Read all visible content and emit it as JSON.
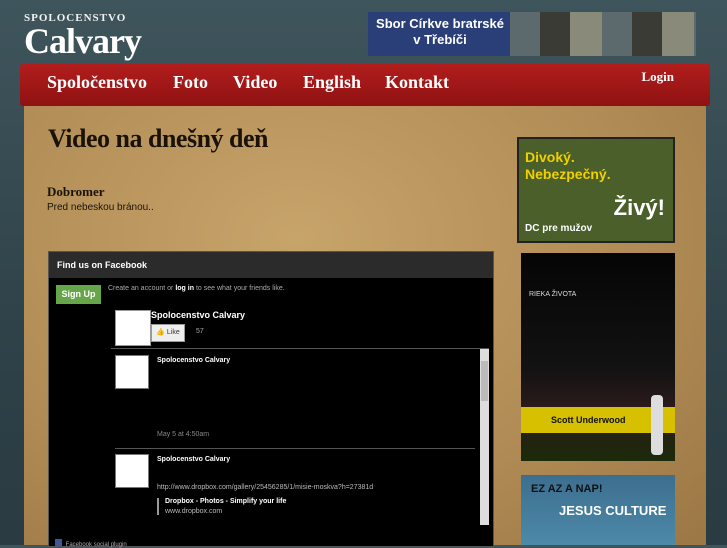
{
  "header": {
    "logo_small": "SPOLOCENSTVO",
    "logo_big": "Calvary",
    "banner_text": "Sbor Církve bratrské v Třebíči"
  },
  "nav": {
    "items": [
      "Spoločenstvo",
      "Foto",
      "Video",
      "English",
      "Kontakt"
    ],
    "login": "Login"
  },
  "main": {
    "title": "Video na dnešný deň",
    "post_title": "Dobromer",
    "post_text": "Pred nebeskou bránou.."
  },
  "facebook": {
    "header": "Find us on Facebook",
    "signup": "Sign Up",
    "create_prefix": "Create an account or",
    "login_link": "log in",
    "create_suffix": "to see what your friends like.",
    "page_name": "Spolocenstvo Calvary",
    "like_label": "Like",
    "like_count": "57",
    "stories": [
      {
        "author": "Spolocenstvo Calvary",
        "time": "May 5 at 4:50am"
      },
      {
        "author": "Spolocenstvo Calvary",
        "url": "http://www.dropbox.com/gallery/25456285/1/misie-moskva?h=27381d",
        "link_title": "Dropbox - Photos - Simplify your life",
        "link_domain": "www.dropbox.com"
      }
    ],
    "plugin_label": "Facebook social plugin"
  },
  "sidebar": {
    "ad1": {
      "line1": "Divoký.",
      "line2": "Nebezpečný.",
      "line3": "Živý!",
      "line4": "DC pre mužov"
    },
    "ad2": {
      "brand": "RIEKA ŽIVOTA",
      "artist": "Scott Underwood"
    },
    "ad3": {
      "title": "EZ AZ A NAP!",
      "sub": "JESUS CULTURE"
    }
  }
}
